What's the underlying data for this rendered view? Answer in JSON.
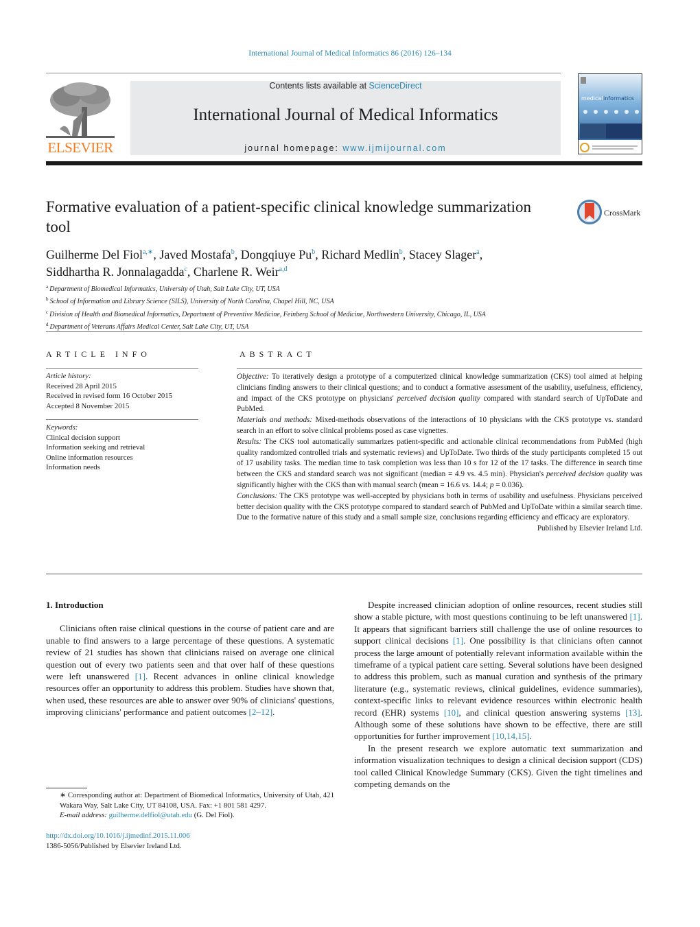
{
  "header": {
    "journal_reference": "International Journal of Medical Informatics 86 (2016) 126–134",
    "publisher_logo_text": "ELSEVIER",
    "contents_prefix": "Contents lists available at ",
    "contents_link": "ScienceDirect",
    "journal_title": "International Journal of Medical Informatics",
    "homepage_prefix": "journal homepage: ",
    "homepage_link": "www.ijmijournal.com",
    "cover_title_a": "medical",
    "cover_title_b": "informatics",
    "crossmark_label": "CrossMark"
  },
  "article": {
    "title": "Formative evaluation of a patient-specific clinical knowledge summarization tool",
    "authors": [
      {
        "name": "Guilherme Del Fiol",
        "sup": "a,∗"
      },
      {
        "name": "Javed Mostafa",
        "sup": "b"
      },
      {
        "name": "Dongqiuye Pu",
        "sup": "b"
      },
      {
        "name": "Richard Medlin",
        "sup": "b"
      },
      {
        "name": "Stacey Slager",
        "sup": "a"
      },
      {
        "name": "Siddhartha R. Jonnalagadda",
        "sup": "c"
      },
      {
        "name": "Charlene R. Weir",
        "sup": "a,d"
      }
    ],
    "affiliations": [
      {
        "key": "a",
        "text": "Department of Biomedical Informatics, University of Utah, Salt Lake City, UT, USA"
      },
      {
        "key": "b",
        "text": "School of Information and Library Science (SILS), University of North Carolina, Chapel Hill, NC, USA"
      },
      {
        "key": "c",
        "text": "Division of Health and Biomedical Informatics, Department of Preventive Medicine, Feinberg School of Medicine, Northwestern University, Chicago, IL, USA"
      },
      {
        "key": "d",
        "text": "Department of Veterans Affairs Medical Center, Salt Lake City, UT, USA"
      }
    ]
  },
  "article_info": {
    "heading": "ARTICLE INFO",
    "history_label": "Article history:",
    "history": [
      "Received 28 April 2015",
      "Received in revised form 16 October 2015",
      "Accepted 8 November 2015"
    ],
    "keywords_label": "Keywords:",
    "keywords": [
      "Clinical decision support",
      "Information seeking and retrieval",
      "Online information resources",
      "Information needs"
    ]
  },
  "abstract": {
    "heading": "ABSTRACT",
    "objective_label": "Objective:",
    "objective_text_1": " To iteratively design a prototype of a computerized clinical knowledge summarization (CKS) tool aimed at helping clinicians finding answers to their clinical questions; and to conduct a formative assessment of the usability, usefulness, efficiency, and impact of the CKS prototype on physicians' ",
    "objective_em": "perceived decision quality",
    "objective_text_2": " compared with standard search of UpToDate and PubMed.",
    "methods_label": "Materials and methods:",
    "methods_text": " Mixed-methods observations of the interactions of 10 physicians with the CKS prototype vs. standard search in an effort to solve clinical problems posed as case vignettes.",
    "results_label": "Results:",
    "results_text_1": " The CKS tool automatically summarizes patient-specific and actionable clinical recommendations from PubMed (high quality randomized controlled trials and systematic reviews) and UpToDate. Two thirds of the study participants completed 15 out of 17 usability tasks. The median time to task completion was less than 10 s for 12 of the 17 tasks. The difference in search time between the CKS and standard search was not significant (median = 4.9 vs. 4.5 min). Physician's ",
    "results_em": "perceived decision quality",
    "results_text_2": " was significantly higher with the CKS than with manual search (mean = 16.6 vs. 14.4; ",
    "results_p": "p",
    "results_text_3": " = 0.036).",
    "conclusions_label": "Conclusions:",
    "conclusions_text": " The CKS prototype was well-accepted by physicians both in terms of usability and usefulness. Physicians perceived better decision quality with the CKS prototype compared to standard search of PubMed and UpToDate within a similar search time. Due to the formative nature of this study and a small sample size, conclusions regarding efficiency and efficacy are exploratory.",
    "published_by": "Published by Elsevier Ireland Ltd."
  },
  "body": {
    "section_title": "1.  Introduction",
    "p1_a": "Clinicians often raise clinical questions in the course of patient care and are unable to find answers to a large percentage of these questions. A systematic review of 21 studies has shown that clinicians raised on average one clinical question out of every two patients seen and that over half of these questions were left unanswered ",
    "p1_c1": "[1]",
    "p1_b": ". Recent advances in online clinical knowledge resources offer an opportunity to address this problem. Studies have shown that, when used, these resources are able to answer over 90% of clinicians' questions, improving clinicians' performance and patient outcomes ",
    "p1_c2": "[2–12]",
    "p1_end": ".",
    "p2_a": "Despite increased clinician adoption of online resources, recent studies still show a stable picture, with most questions continuing to be left unanswered ",
    "p2_c1": "[1]",
    "p2_b": ". It appears that significant barriers still challenge the use of online resources to support clinical decisions ",
    "p2_c2": "[1]",
    "p2_c": ". One possibility is that clinicians often cannot process the large amount of potentially relevant information available within the timeframe of a typical patient care setting. Several solutions have been designed to address this problem, such as manual curation and synthesis of the primary literature (e.g., systematic reviews, clinical guidelines, evidence summaries), context-specific links to relevant evidence resources within electronic health record (EHR) systems ",
    "p2_c3": "[10]",
    "p2_d": ", and clinical question answering systems ",
    "p2_c4": "[13]",
    "p2_e": ". Although some of these solutions have shown to be effective, there are still opportunities for further improvement ",
    "p2_c5": "[10,14,15]",
    "p2_end": ".",
    "p3": "In the present research we explore automatic text summarization and information visualization techniques to design a clinical decision support (CDS) tool called Clinical Knowledge Summary (CKS). Given the tight timelines and competing demands on the"
  },
  "footnote": {
    "star_text": "∗ Corresponding author at: Department of Biomedical Informatics, University of Utah, 421 Wakara Way, Salt Lake City, UT 84108, USA. Fax: +1 801 581 4297.",
    "email_label": "E-mail address:",
    "email": "guilherme.delfiol@utah.edu",
    "email_suffix": " (G. Del Fiol).",
    "doi": "http://dx.doi.org/10.1016/j.ijmedinf.2015.11.006",
    "issn_line": "1386-5056/Published by Elsevier Ireland Ltd."
  },
  "colors": {
    "link": "#2a8ab3",
    "elsevier_orange": "#f47b20",
    "masthead_bg": "#e8e9eb"
  }
}
